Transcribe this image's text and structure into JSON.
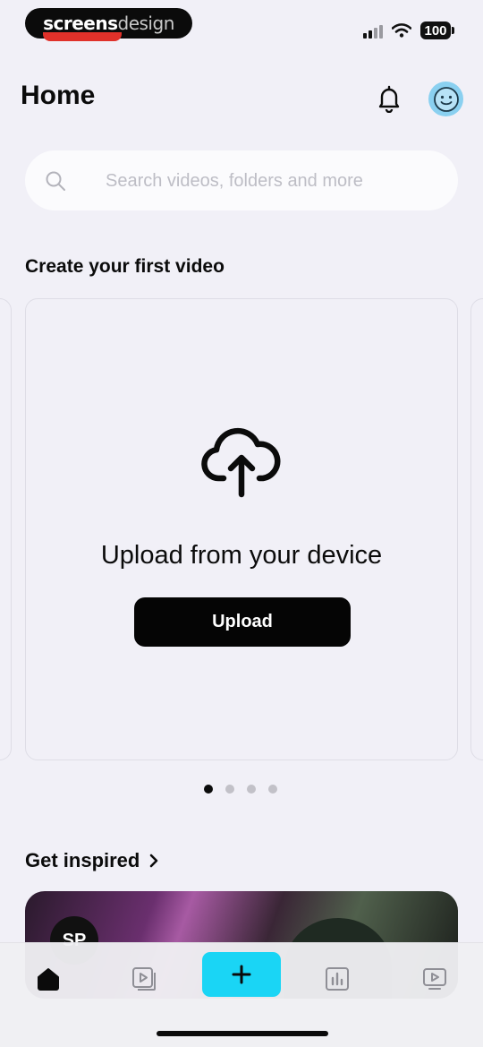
{
  "status_bar": {
    "watermark_bold": "screens",
    "watermark_light": "design",
    "battery": "100"
  },
  "header": {
    "title": "Home"
  },
  "search": {
    "placeholder": "Search videos, folders and more"
  },
  "create_section": {
    "heading": "Create your first video",
    "card_title": "Upload from your device",
    "button_label": "Upload",
    "pages": 4,
    "active_page": 1
  },
  "inspired_section": {
    "heading": "Get inspired",
    "logo_text": "SP"
  },
  "tab_bar": {
    "items": [
      "home-icon",
      "videos-icon",
      "create-plus-icon",
      "analytics-icon",
      "channel-icon"
    ],
    "active": "home",
    "accent": "#1ad5f5"
  },
  "colors": {
    "background": "#f1f0f7",
    "primary": "#050505",
    "avatar": "#8ad0f0"
  }
}
